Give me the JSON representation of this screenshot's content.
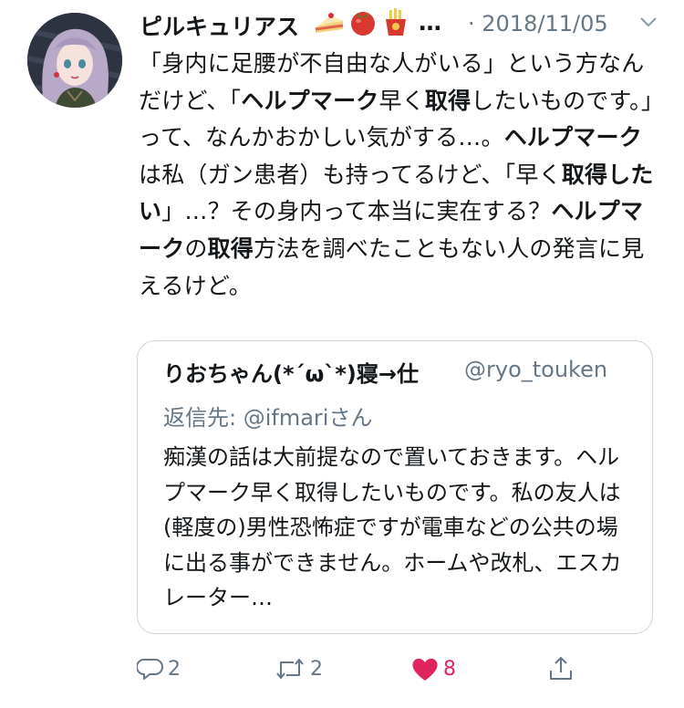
{
  "tweet": {
    "display_name": "ピルキュリアス",
    "emoji_names": [
      "cake-icon",
      "tomato-icon",
      "fries-icon"
    ],
    "name_ellipsis": "…",
    "date_separator": "·",
    "date": "2018/11/05",
    "body_segments": [
      {
        "text": "「身内に足腰が不自由な人がいる」という方なんだけど、「",
        "bold": false
      },
      {
        "text": "ヘルプマーク",
        "bold": true
      },
      {
        "text": "早く",
        "bold": false
      },
      {
        "text": "取得",
        "bold": true
      },
      {
        "text": "したいものです。」って、なんかおかしい気がする…。",
        "bold": false
      },
      {
        "text": "ヘルプマーク",
        "bold": true
      },
      {
        "text": "は私（ガン患者）も持ってるけど、「早く",
        "bold": false
      },
      {
        "text": "取得したい",
        "bold": true
      },
      {
        "text": "」…？その身内って本当に実在する？",
        "bold": false
      },
      {
        "text": "ヘルプマーク",
        "bold": true
      },
      {
        "text": "の",
        "bold": false
      },
      {
        "text": "取得",
        "bold": true
      },
      {
        "text": "方法を調べたこともない人の発言に見えるけど。",
        "bold": false
      }
    ]
  },
  "quoted": {
    "author": "りおちゃん(*´ω`*)寝→仕",
    "handle": "@ryo_touken",
    "reply_to_prefix": "返信先: ",
    "reply_to_handle": "@ifmari",
    "reply_to_suffix": "さん",
    "text": "痴漢の話は大前提なので置いておきます。ヘルプマーク早く取得したいものです。私の友人は(軽度の)男性恐怖症ですが電車などの公共の場に出る事ができません。ホームや改札、エスカレーター…"
  },
  "actions": {
    "reply_count": "2",
    "retweet_count": "2",
    "like_count": "8",
    "like_color": "#e0245e",
    "icon_color": "#657786"
  }
}
